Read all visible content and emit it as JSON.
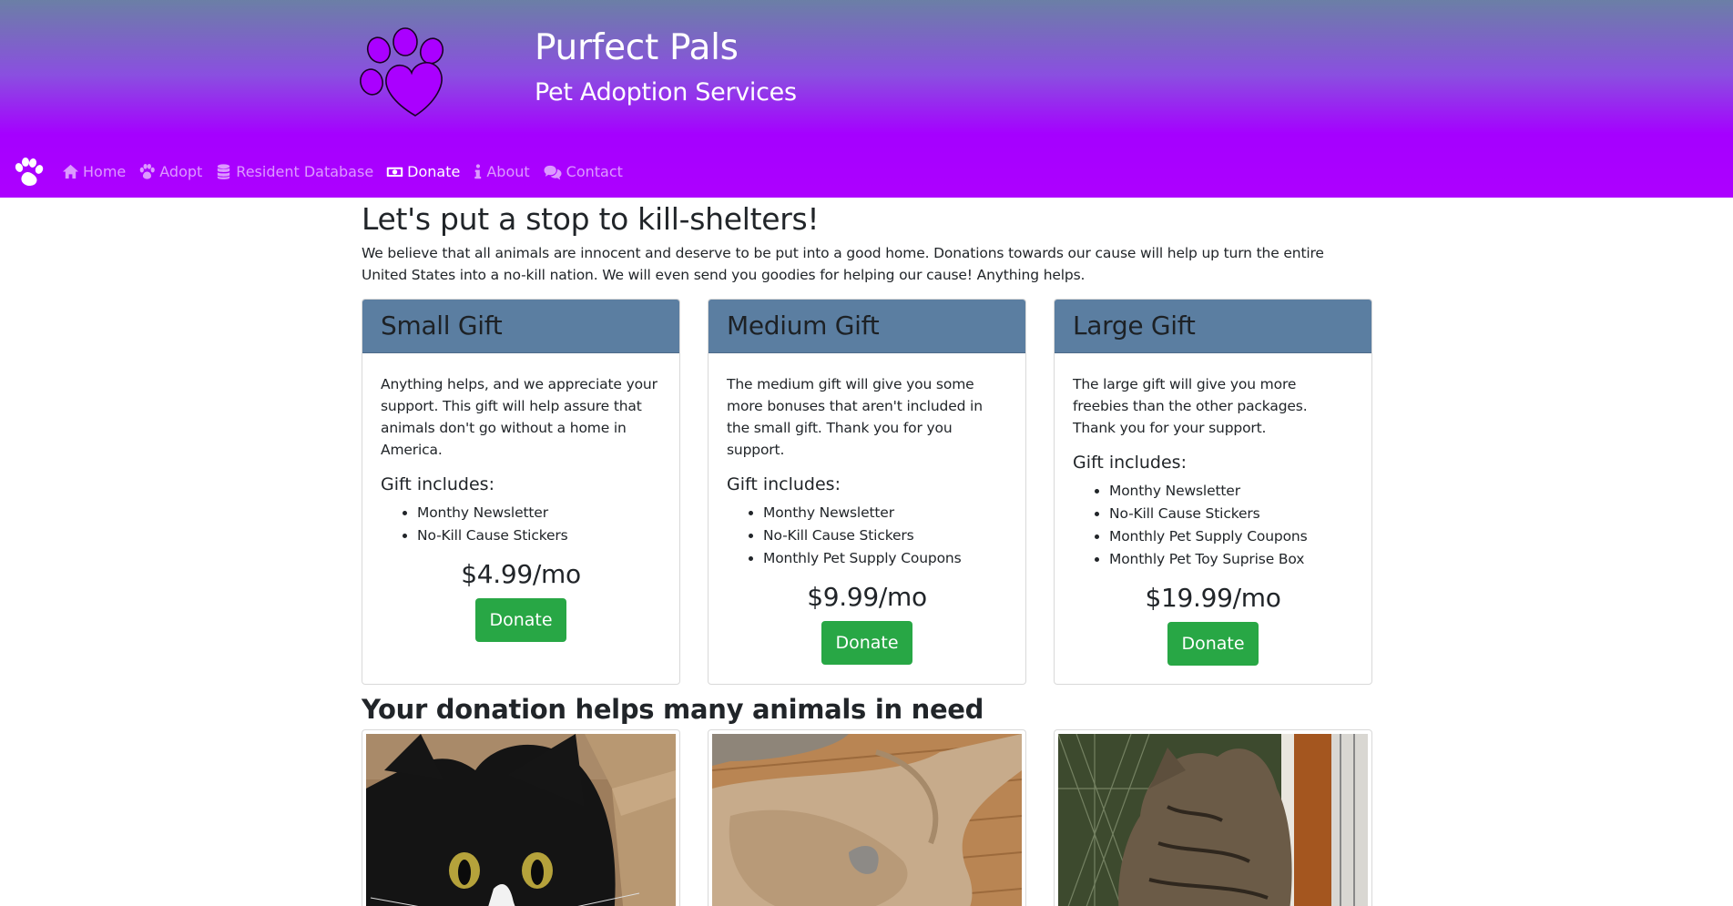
{
  "brand": {
    "title": "Purfect Pals",
    "subtitle": "Pet Adoption Services",
    "logo_icon": "paw-heart-icon",
    "logo_color": "#aa00ff"
  },
  "nav": {
    "items": [
      {
        "label": "Home",
        "icon": "home-icon",
        "active": false
      },
      {
        "label": "Adopt",
        "icon": "paw-icon",
        "active": false
      },
      {
        "label": "Resident Database",
        "icon": "database-icon",
        "active": false
      },
      {
        "label": "Donate",
        "icon": "money-bill-icon",
        "active": true
      },
      {
        "label": "About",
        "icon": "info-icon",
        "active": false
      },
      {
        "label": "Contact",
        "icon": "comments-icon",
        "active": false
      }
    ]
  },
  "main": {
    "title": "Let's put a stop to kill-shelters!",
    "intro": "We believe that all animals are innocent and deserve to be put into a good home. Donations towards our cause will help up turn the entire United States into a no-kill nation. We will even send you goodies for helping our cause! Anything helps.",
    "section_title": "Your donation helps many animals in need"
  },
  "gifts": [
    {
      "name": "Small Gift",
      "description": "Anything helps, and we appreciate your support. This gift will help assure that animals don't go without a home in America.",
      "includes_label": "Gift includes:",
      "items": [
        "Monthy Newsletter",
        "No-Kill Cause Stickers"
      ],
      "price": "$4.99/mo",
      "button": "Donate"
    },
    {
      "name": "Medium Gift",
      "description": "The medium gift will give you some more bonuses that aren't included in the small gift. Thank you for you support.",
      "includes_label": "Gift includes:",
      "items": [
        "Monthy Newsletter",
        "No-Kill Cause Stickers",
        "Monthly Pet Supply Coupons"
      ],
      "price": "$9.99/mo",
      "button": "Donate"
    },
    {
      "name": "Large Gift",
      "description": "The large gift will give you more freebies than the other packages. Thank you for your support.",
      "includes_label": "Gift includes:",
      "items": [
        "Monthy Newsletter",
        "No-Kill Cause Stickers",
        "Monthly Pet Supply Coupons",
        "Monthly Pet Toy Suprise Box"
      ],
      "price": "$19.99/mo",
      "button": "Donate"
    }
  ],
  "colors": {
    "header_top": "#6b7fa6",
    "header_bottom": "#ad00ff",
    "card_header": "#5b7ea1",
    "donate_button": "#28a745"
  }
}
